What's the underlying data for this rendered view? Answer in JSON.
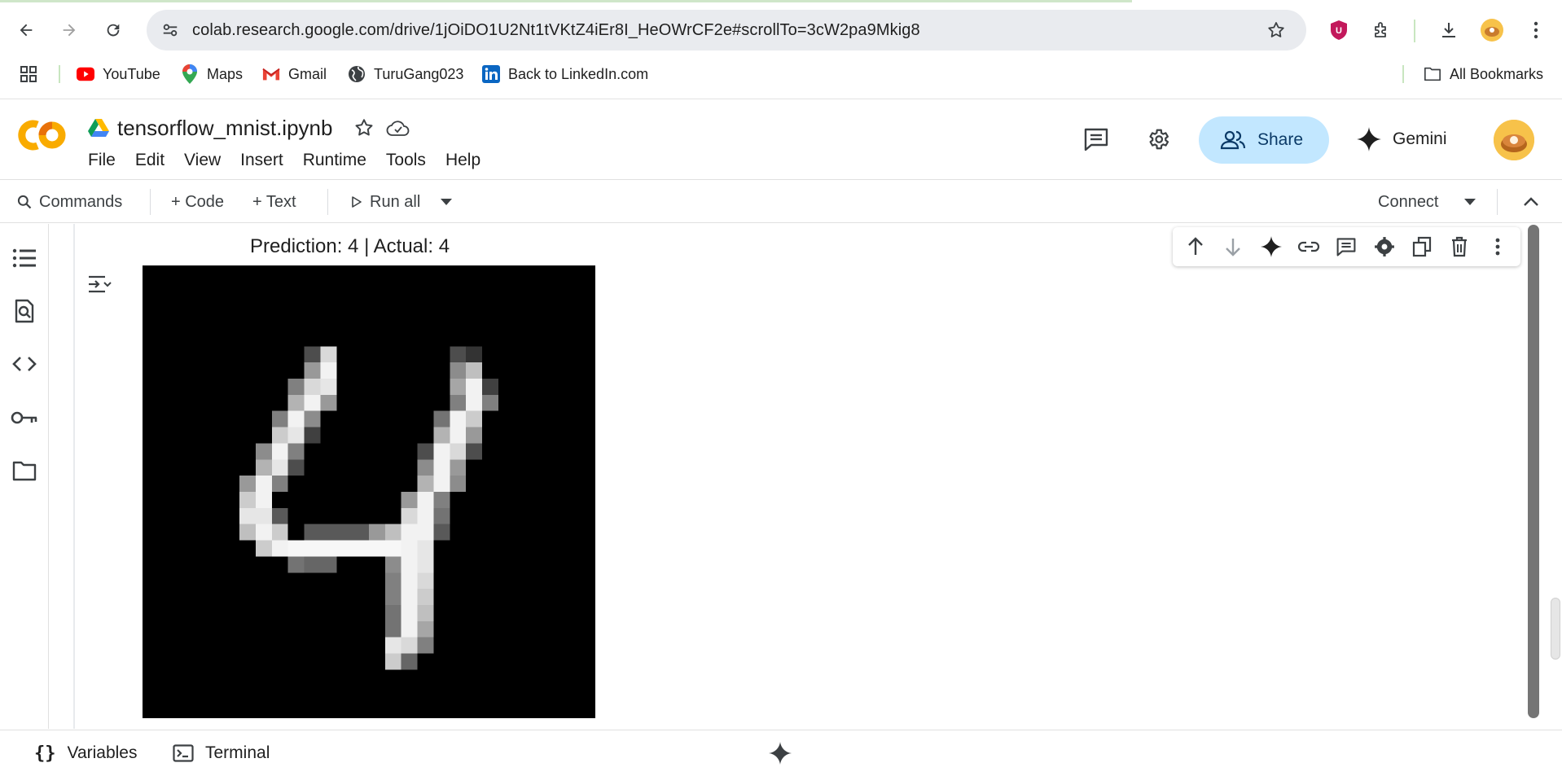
{
  "browser": {
    "url": "colab.research.google.com/drive/1jOiDO1U2Nt1tVKtZ4iEr8I_HeOWrCF2e#scrollTo=3cW2pa9Mkig8",
    "bookmarks": [
      "YouTube",
      "Maps",
      "Gmail",
      "TuruGang023",
      "Back to LinkedIn.com"
    ],
    "all_bookmarks": "All Bookmarks"
  },
  "colab": {
    "notebook_title": "tensorflow_mnist.ipynb",
    "menu": [
      "File",
      "Edit",
      "View",
      "Insert",
      "Runtime",
      "Tools",
      "Help"
    ],
    "share_label": "Share",
    "gemini_label": "Gemini"
  },
  "toolbar": {
    "commands": "Commands",
    "code": "+ Code",
    "text": "+ Text",
    "run_all": "Run all",
    "connect": "Connect"
  },
  "output": {
    "plot_title": "Prediction: 4 | Actual: 4"
  },
  "bottom": {
    "variables": "Variables",
    "terminal": "Terminal"
  },
  "colors": {
    "share_bg": "#c2e7ff",
    "accent_orange": "#f9ab00",
    "youtube_red": "#ff0000"
  }
}
